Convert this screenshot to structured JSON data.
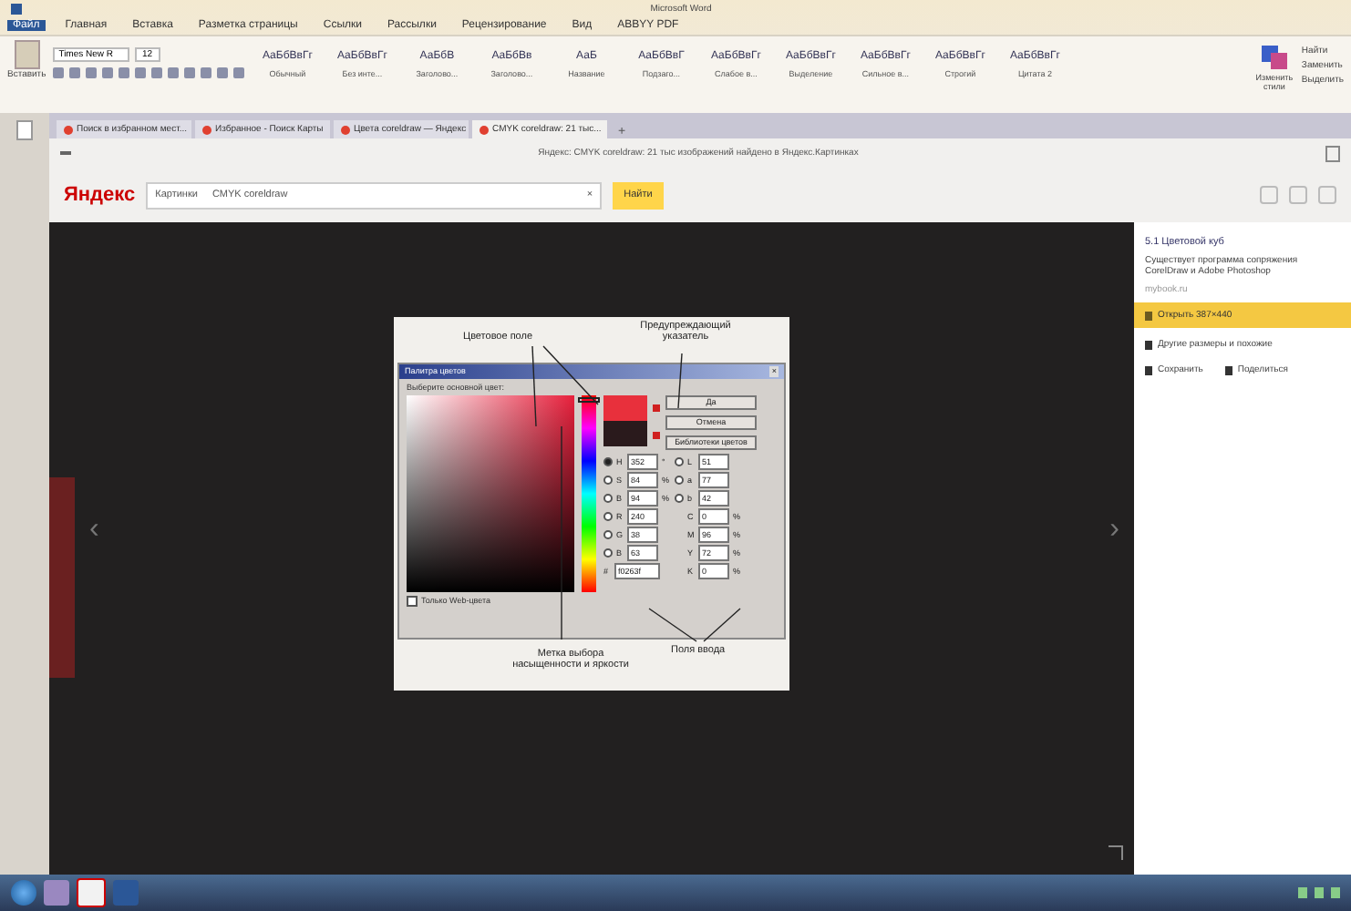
{
  "word": {
    "title": "Microsoft Word",
    "tabs": [
      {
        "label": "Файл",
        "selected": true
      },
      {
        "label": "Главная",
        "selected": false
      },
      {
        "label": "Вставка",
        "selected": false
      },
      {
        "label": "Разметка страницы",
        "selected": false
      },
      {
        "label": "Ссылки",
        "selected": false
      },
      {
        "label": "Рассылки",
        "selected": false
      },
      {
        "label": "Рецензирование",
        "selected": false
      },
      {
        "label": "Вид",
        "selected": false
      },
      {
        "label": "ABBYY PDF",
        "selected": false
      }
    ],
    "paste": "Вставить",
    "font": "Times New R",
    "size": "12",
    "styles": [
      {
        "sample": "АаБбВвГг",
        "name": "Обычный"
      },
      {
        "sample": "АаБбВвГг",
        "name": "Без инте..."
      },
      {
        "sample": "АаБбВ",
        "name": "Заголово..."
      },
      {
        "sample": "АаБбВв",
        "name": "Заголово..."
      },
      {
        "sample": "АаБ",
        "name": "Название"
      },
      {
        "sample": "АаБбВвГ",
        "name": "Подзаго..."
      },
      {
        "sample": "АаБбВвГг",
        "name": "Слабое в..."
      },
      {
        "sample": "АаБбВвГг",
        "name": "Выделение"
      },
      {
        "sample": "АаБбВвГг",
        "name": "Сильное в..."
      },
      {
        "sample": "АаБбВвГг",
        "name": "Строгий"
      },
      {
        "sample": "АаБбВвГг",
        "name": "Цитата 2"
      }
    ],
    "change_styles": "Изменить стили",
    "editing": [
      "Найти",
      "Заменить",
      "Выделить"
    ]
  },
  "browser": {
    "tabs": [
      {
        "label": "Поиск в избранном мест...",
        "selected": false
      },
      {
        "label": "Избранное - Поиск Карты",
        "selected": false
      },
      {
        "label": "Цвета coreldraw — Яндекс",
        "selected": false
      },
      {
        "label": "CMYK coreldraw: 21 тыс...",
        "selected": true
      }
    ],
    "new_tab": "+",
    "address": "Яндекс: CMYK coreldraw: 21 тыс изображений найдено в Яндекс.Картинках",
    "logo": "Яндекс",
    "scope": "Картинки",
    "query": "CMYK coreldraw",
    "search_button": "Найти",
    "clear": "×"
  },
  "viewer": {
    "prev": "‹",
    "next": "›",
    "annotations": {
      "field": "Цветовое поле",
      "warning": "Предупреждающий указатель",
      "marker": "Метка выбора насыщенности и яркости",
      "inputs": "Поля ввода"
    },
    "dialog": {
      "title": "Палитра цветов",
      "close": "×",
      "prompt": "Выберите основной цвет:",
      "buttons": [
        "Да",
        "Отмена",
        "Библиотеки цветов"
      ],
      "left_fields": [
        {
          "label": "H",
          "value": "352",
          "unit": "°",
          "selected": true
        },
        {
          "label": "S",
          "value": "84",
          "unit": "%",
          "selected": false
        },
        {
          "label": "B",
          "value": "94",
          "unit": "%",
          "selected": false
        },
        {
          "label": "R",
          "value": "240",
          "selected": false
        },
        {
          "label": "G",
          "value": "38",
          "selected": false
        },
        {
          "label": "B",
          "value": "63",
          "selected": false
        }
      ],
      "right_fields": [
        {
          "kind": "radio",
          "label": "L",
          "value": "51",
          "selected": false
        },
        {
          "kind": "radio",
          "label": "a",
          "value": "77",
          "selected": false
        },
        {
          "kind": "radio",
          "label": "b",
          "value": "42",
          "selected": false
        },
        {
          "kind": "plain",
          "label": "C",
          "value": "0",
          "unit": "%"
        },
        {
          "kind": "plain",
          "label": "M",
          "value": "96",
          "unit": "%"
        },
        {
          "kind": "plain",
          "label": "Y",
          "value": "72",
          "unit": "%"
        },
        {
          "kind": "plain",
          "label": "K",
          "value": "0",
          "unit": "%"
        }
      ],
      "hue": {
        "level": 0.98
      },
      "hex_label": "#",
      "hex": "f0263f",
      "web_only": {
        "label": "Только Web-цвета",
        "checked": false
      }
    },
    "panel": {
      "title": "5.1 Цветовой куб",
      "description": "Существует программа сопряжения CorelDraw и Adobe Photoshop",
      "source": "mybook.ru",
      "open": "Открыть 387×440",
      "similar": "Другие размеры и похожие",
      "save": "Сохранить",
      "share": "Поделиться"
    }
  }
}
